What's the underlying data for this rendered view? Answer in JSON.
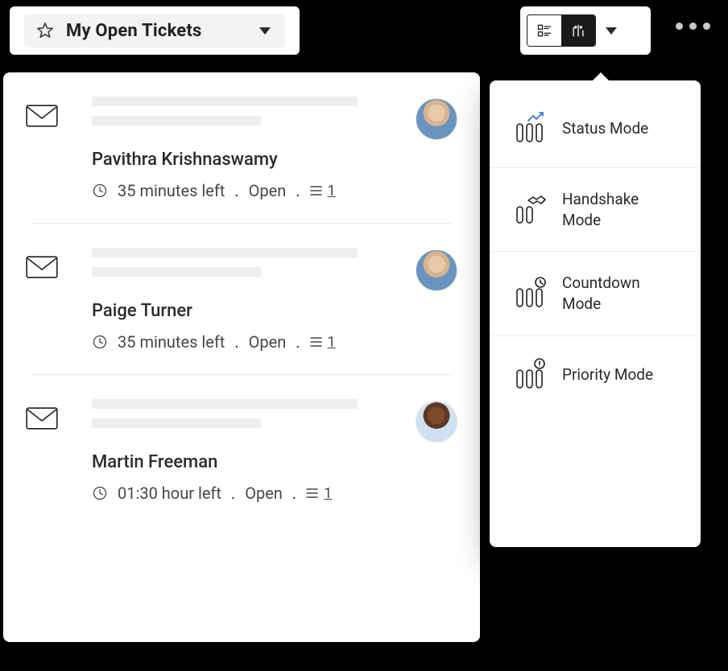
{
  "header": {
    "view_title": "My Open Tickets"
  },
  "tickets": [
    {
      "contact_name": "Pavithra Krishnaswamy",
      "sla_text": "35 minutes left",
      "status": "Open",
      "thread_count": "1",
      "avatar_variant": "a"
    },
    {
      "contact_name": "Paige Turner",
      "sla_text": "35 minutes left",
      "status": "Open",
      "thread_count": "1",
      "avatar_variant": "a"
    },
    {
      "contact_name": "Martin Freeman",
      "sla_text": "01:30 hour left",
      "status": "Open",
      "thread_count": "1",
      "avatar_variant": "b"
    }
  ],
  "mode_menu": {
    "items": [
      {
        "label": "Status Mode",
        "icon": "status"
      },
      {
        "label": "Handshake Mode",
        "icon": "handshake"
      },
      {
        "label": "Countdown Mode",
        "icon": "countdown"
      },
      {
        "label": "Priority Mode",
        "icon": "priority"
      }
    ]
  }
}
